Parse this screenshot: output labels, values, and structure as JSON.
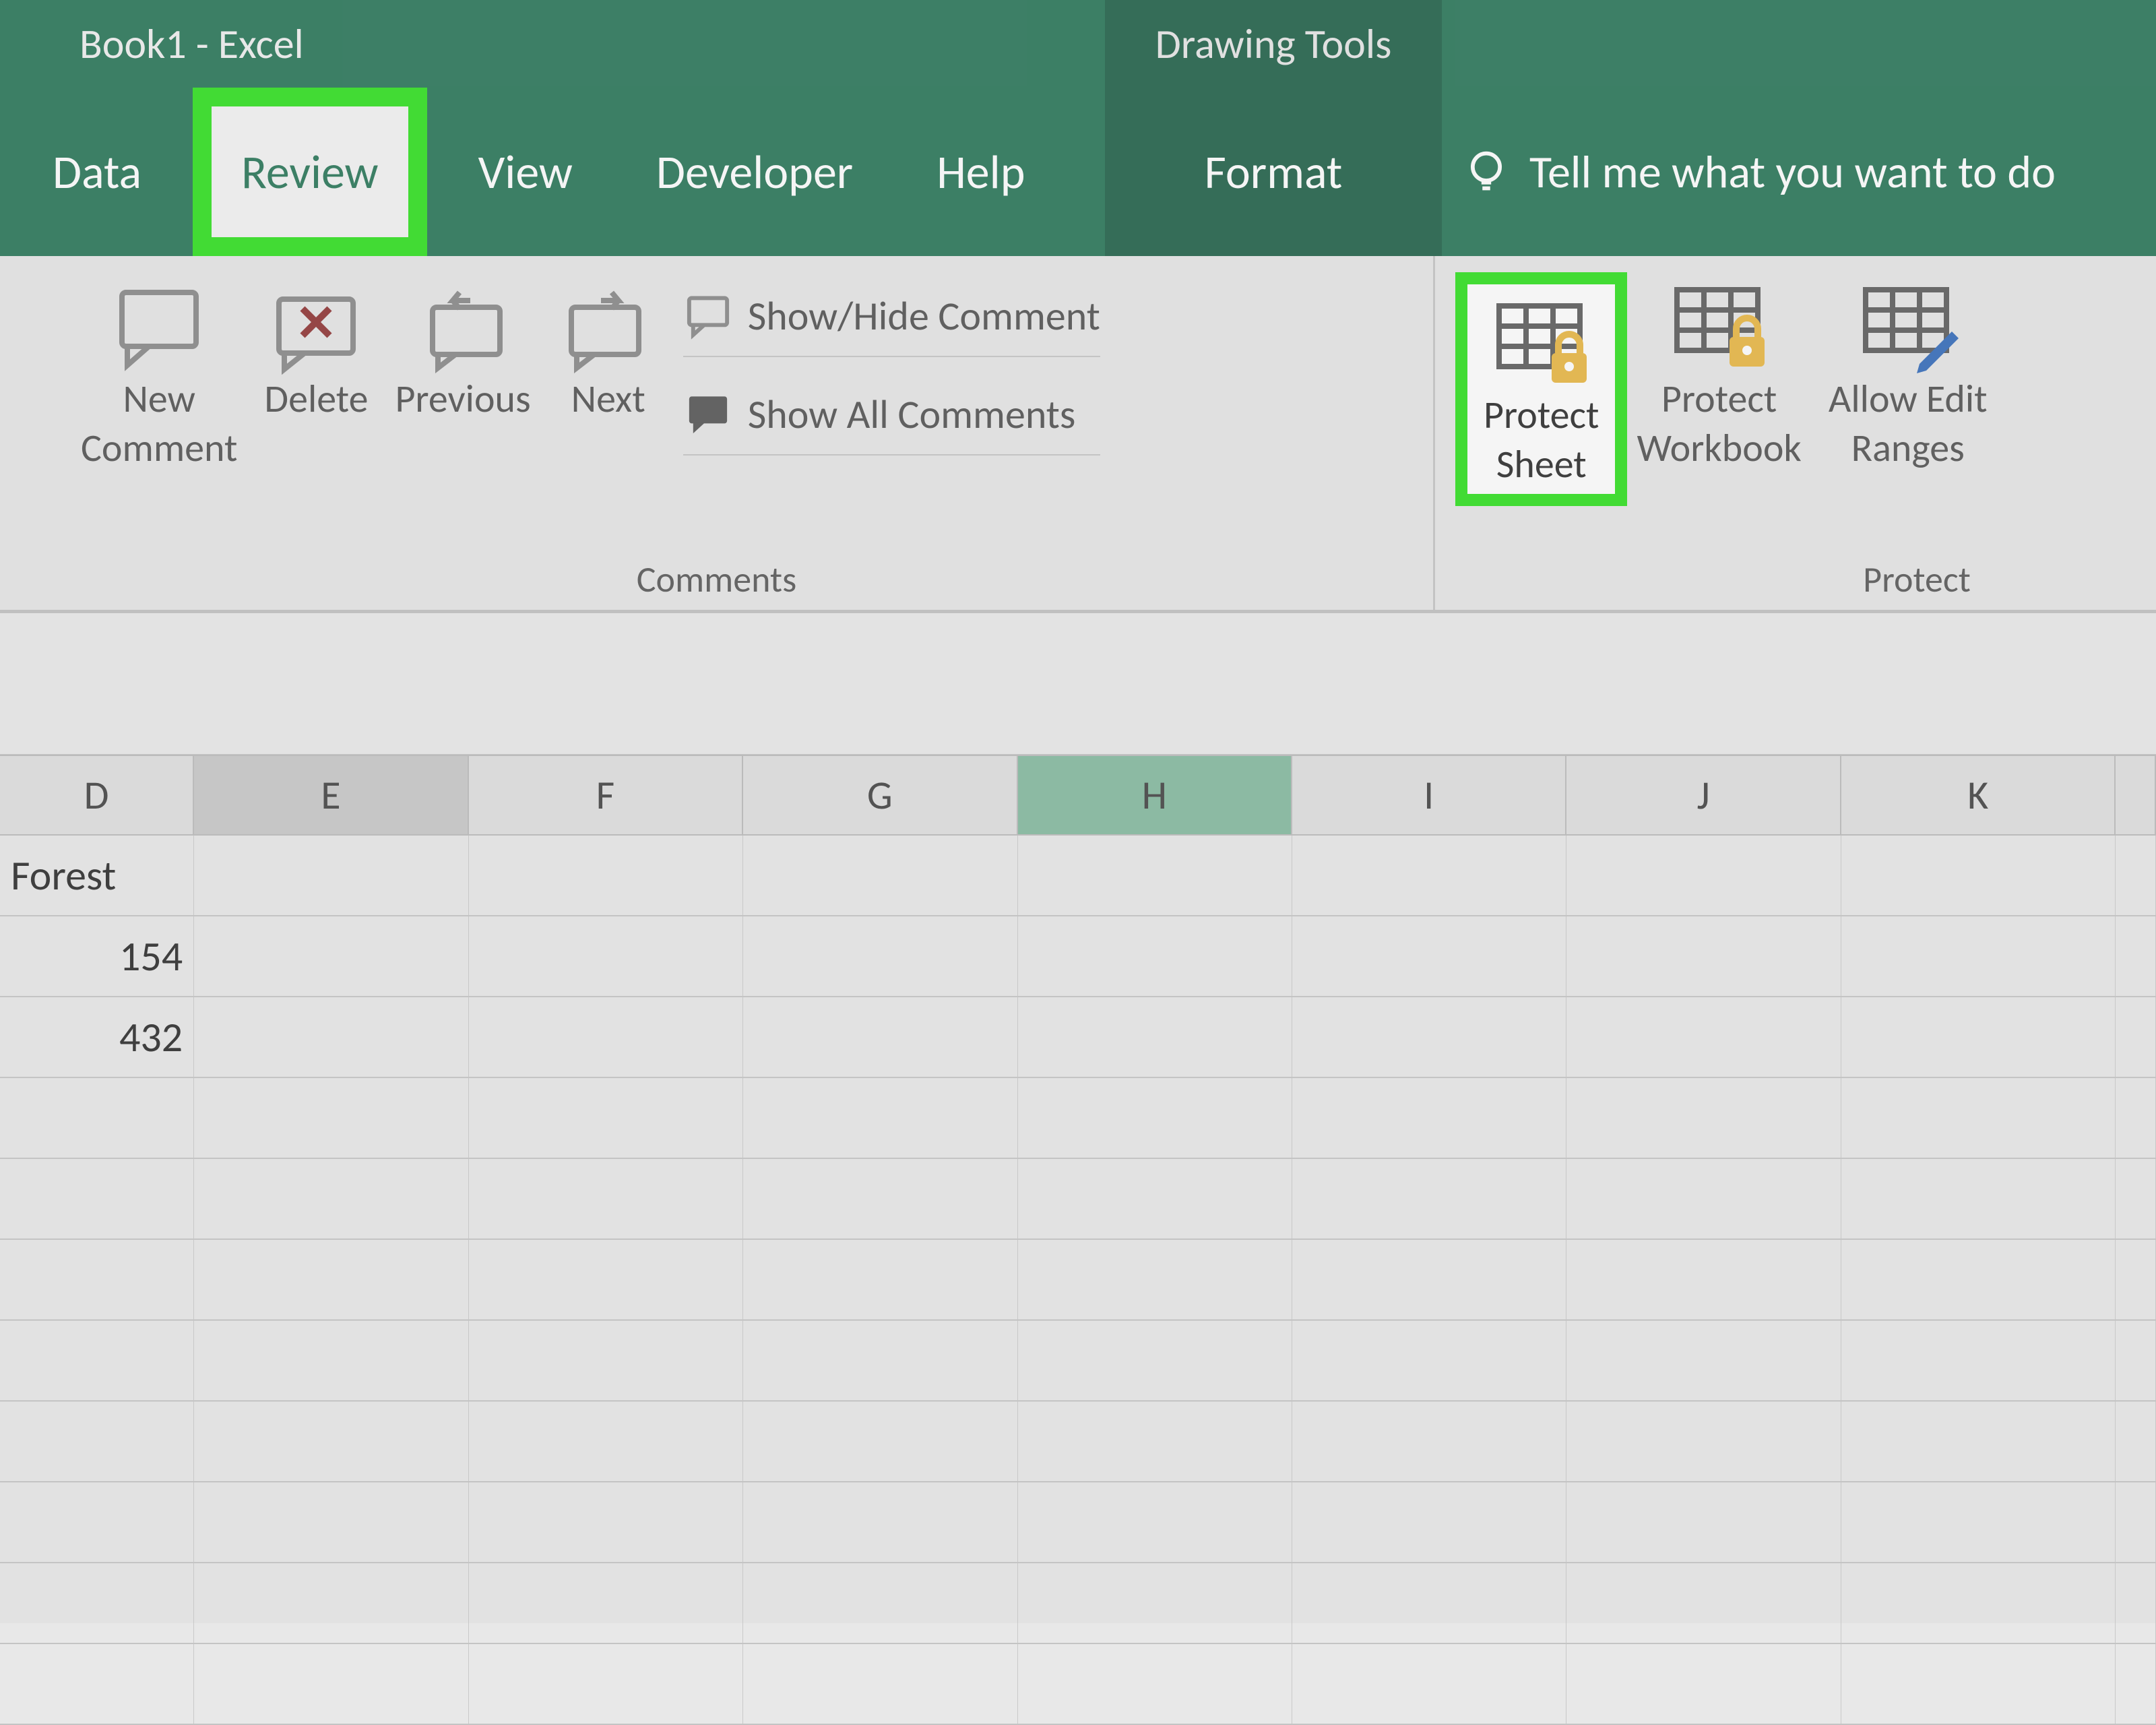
{
  "title": "Book1  -  Excel",
  "contextualTitle": "Drawing Tools",
  "tabs": {
    "data": "Data",
    "review": "Review",
    "view": "View",
    "developer": "Developer",
    "help": "Help",
    "format": "Format"
  },
  "tellMe": "Tell me what you want to do",
  "ribbon": {
    "comments": {
      "newComment1": "New",
      "newComment2": "Comment",
      "delete": "Delete",
      "previous": "Previous",
      "next": "Next",
      "showHide": "Show/Hide Comment",
      "showAll": "Show All Comments",
      "groupLabel": "Comments"
    },
    "protect": {
      "protectSheet1": "Protect",
      "protectSheet2": "Sheet",
      "protectWorkbook1": "Protect",
      "protectWorkbook2": "Workbook",
      "allowEdit1": "Allow Edit",
      "allowEdit2": "Ranges",
      "groupLabel": "Protect"
    }
  },
  "columns": [
    "D",
    "E",
    "F",
    "G",
    "H",
    "I",
    "J",
    "K"
  ],
  "cells": {
    "D1": "Forest",
    "D2": "154",
    "D3": "432"
  },
  "selectedCols": {
    "highlightGrey": "E",
    "highlightGreen": "H"
  }
}
